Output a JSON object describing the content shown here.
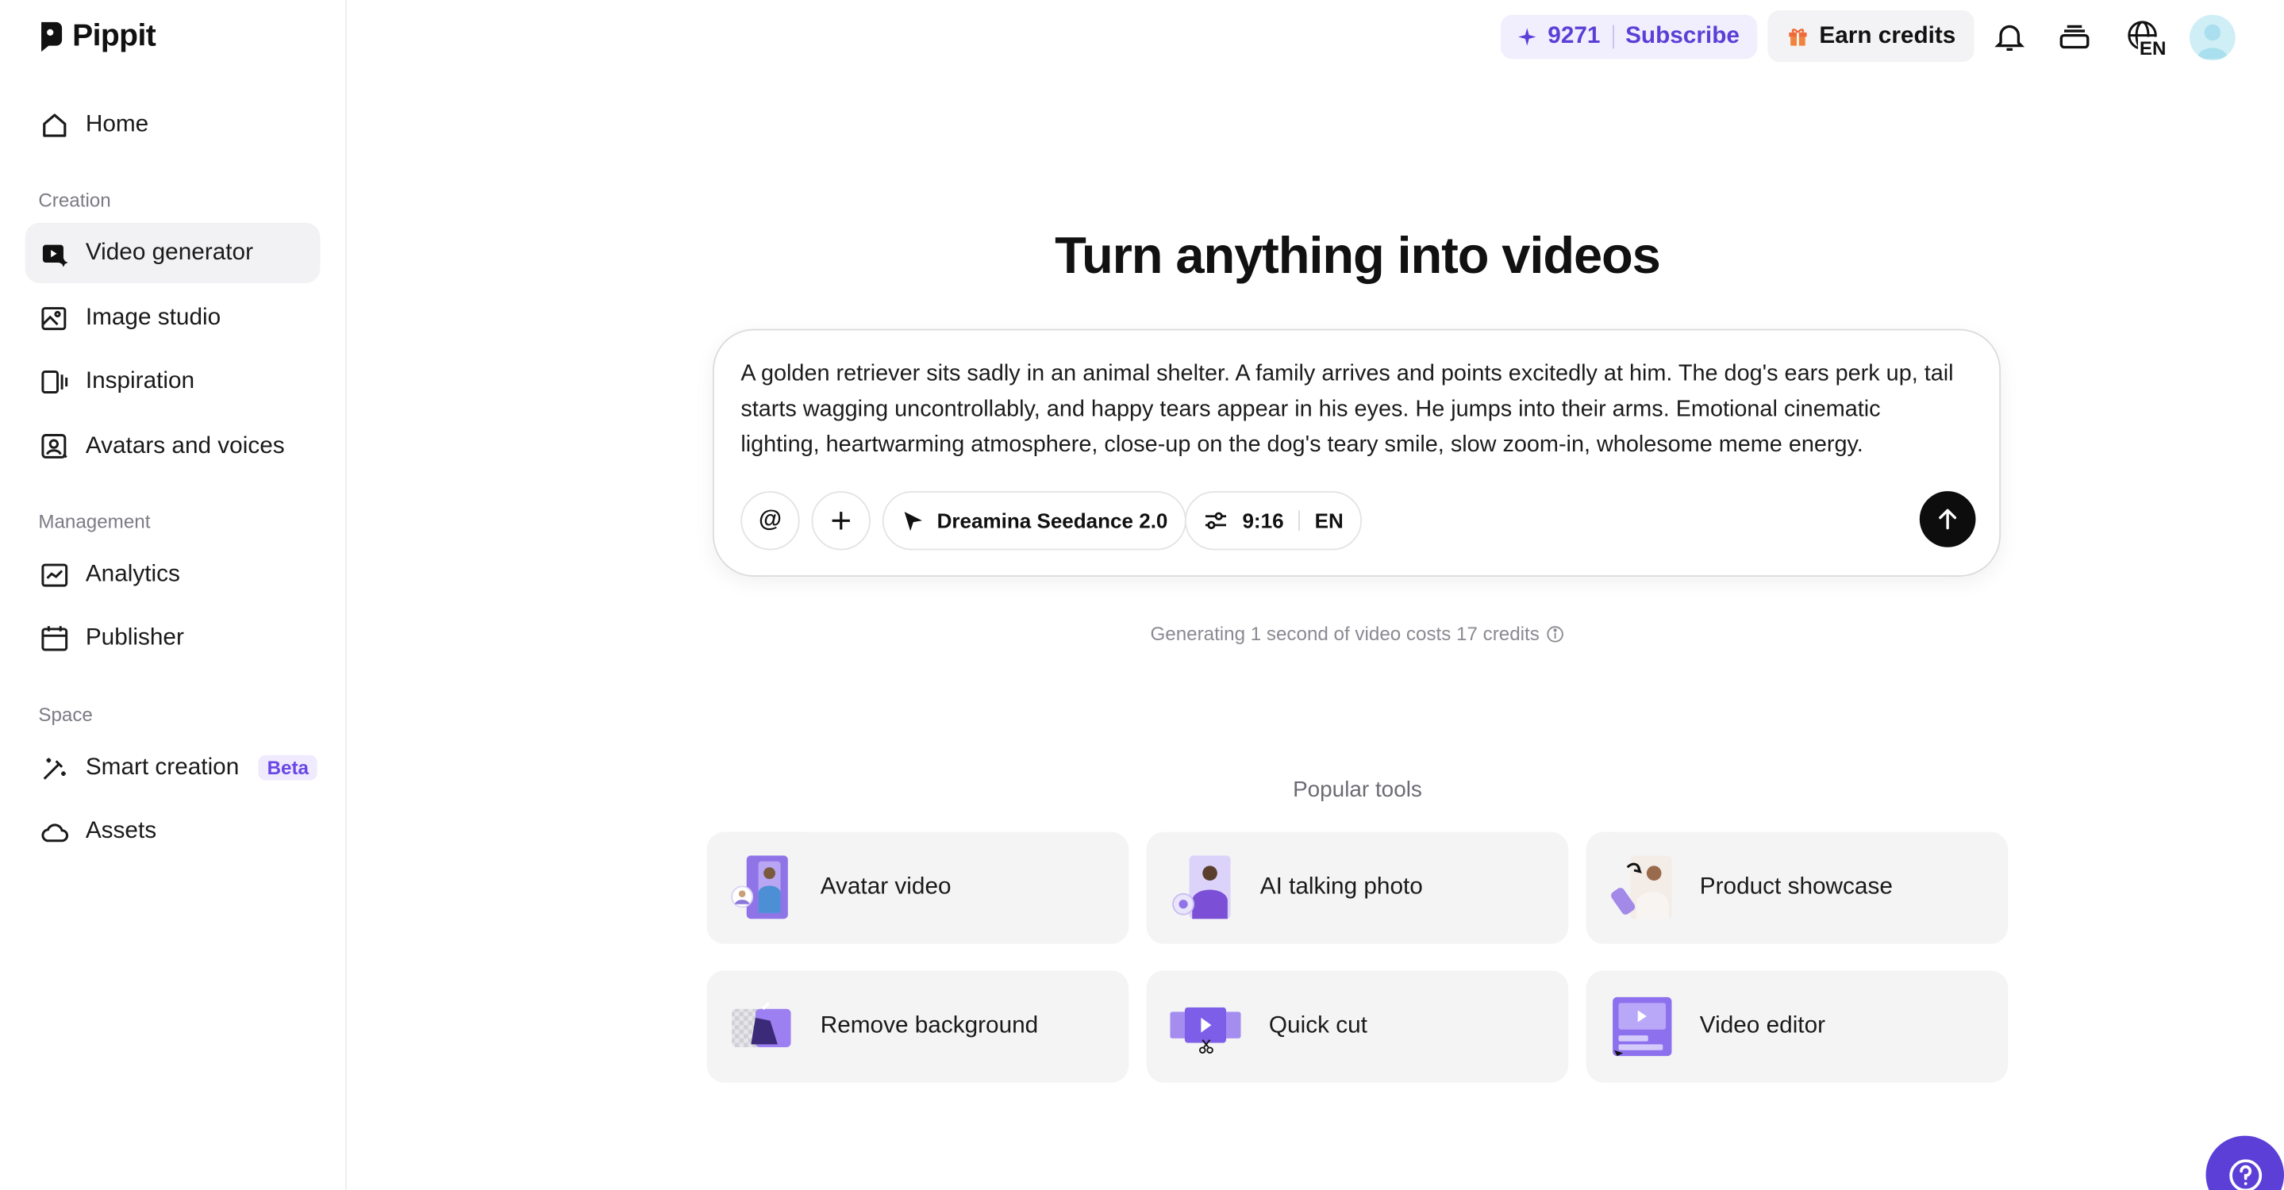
{
  "app": {
    "name": "Pippit"
  },
  "sidebar": {
    "home": "Home",
    "sections": {
      "creation": "Creation",
      "management": "Management",
      "space": "Space"
    },
    "items": [
      {
        "label": "Video generator",
        "icon": "video-generator-icon",
        "active": true
      },
      {
        "label": "Image studio",
        "icon": "image-studio-icon"
      },
      {
        "label": "Inspiration",
        "icon": "inspiration-icon"
      },
      {
        "label": "Avatars and voices",
        "icon": "avatar-voice-icon"
      },
      {
        "label": "Analytics",
        "icon": "analytics-icon"
      },
      {
        "label": "Publisher",
        "icon": "calendar-icon"
      },
      {
        "label": "Smart creation",
        "icon": "magic-wand-icon",
        "badge": "Beta"
      },
      {
        "label": "Assets",
        "icon": "cloud-icon"
      }
    ]
  },
  "topbar": {
    "credits": "9271",
    "subscribe": "Subscribe",
    "earn_credits": "Earn credits",
    "language": "EN"
  },
  "main": {
    "headline": "Turn anything into videos",
    "prompt": "A golden retriever sits sadly in an animal shelter. A family arrives and points excitedly at him. The dog's ears perk up, tail starts wagging uncontrollably, and happy tears appear in his eyes. He jumps into their arms. Emotional cinematic lighting, heartwarming atmosphere, close-up on the dog's teary smile, slow zoom-in, wholesome meme energy.",
    "model": "Dreamina Seedance 2.0",
    "aspect": "9:16",
    "prompt_language": "EN",
    "cost_note": "Generating 1 second of video costs 17 credits",
    "popular_title": "Popular tools",
    "tools": [
      {
        "label": "Avatar video"
      },
      {
        "label": "AI talking photo"
      },
      {
        "label": "Product showcase"
      },
      {
        "label": "Remove background"
      },
      {
        "label": "Quick cut"
      },
      {
        "label": "Video editor"
      }
    ]
  },
  "colors": {
    "accent": "#5b3fd6",
    "accent_bg": "#f1effd",
    "send": "#0d0d0d"
  }
}
